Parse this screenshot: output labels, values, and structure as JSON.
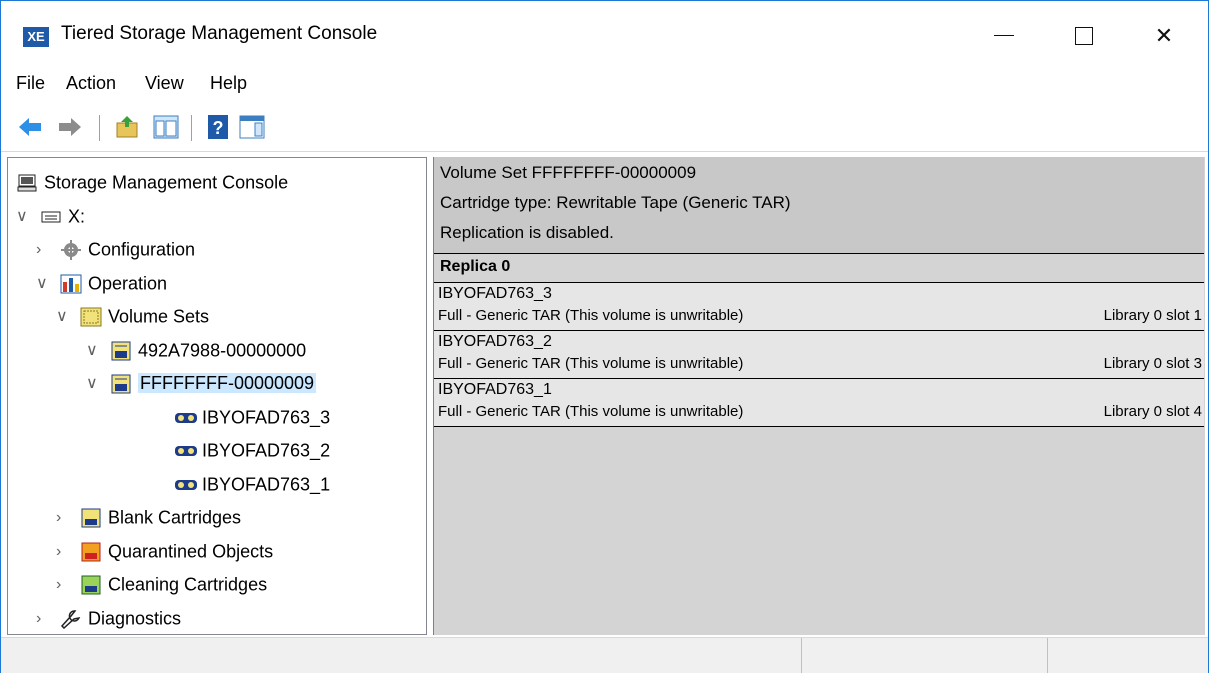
{
  "window": {
    "app_icon_text": "XE",
    "title": "Tiered Storage Management Console"
  },
  "menu": [
    "File",
    "Action",
    "View",
    "Help"
  ],
  "toolbar": {
    "buttons": [
      "back-arrow-icon",
      "forward-arrow-icon",
      "up-folder-icon",
      "show-hide-tree-icon",
      "help-icon",
      "action-pane-icon"
    ]
  },
  "tree": {
    "items": [
      {
        "label": "Storage Management Console",
        "icon": "computer-icon",
        "expander": ""
      },
      {
        "label": "X:",
        "icon": "drive-icon",
        "expander": "∨"
      },
      {
        "label": "Configuration",
        "icon": "gear-icon",
        "expander": "›"
      },
      {
        "label": "Operation",
        "icon": "operation-icon",
        "expander": "∨"
      },
      {
        "label": "Volume Sets",
        "icon": "volume-sets-icon",
        "expander": "∨"
      },
      {
        "label": "492A7988-00000000",
        "icon": "volume-set-icon",
        "expander": "∨"
      },
      {
        "label": "FFFFFFFF-00000009",
        "icon": "volume-set-icon",
        "expander": "∨",
        "selected": true
      },
      {
        "label": "IBYOFAD763_3",
        "icon": "tape-icon",
        "expander": ""
      },
      {
        "label": "IBYOFAD763_2",
        "icon": "tape-icon",
        "expander": ""
      },
      {
        "label": "IBYOFAD763_1",
        "icon": "tape-icon",
        "expander": ""
      },
      {
        "label": "Blank Cartridges",
        "icon": "blank-cartridges-icon",
        "expander": "›"
      },
      {
        "label": "Quarantined Objects",
        "icon": "quarantined-icon",
        "expander": "›"
      },
      {
        "label": "Cleaning Cartridges",
        "icon": "cleaning-icon",
        "expander": "›"
      },
      {
        "label": "Diagnostics",
        "icon": "wrench-icon",
        "expander": "›"
      }
    ]
  },
  "details": {
    "header_lines": [
      "Volume Set FFFFFFFF-00000009",
      "Cartridge type: Rewritable Tape (Generic TAR)",
      "Replication is disabled."
    ],
    "replica_title": "Replica 0",
    "volumes": [
      {
        "name": "IBYOFAD763_3",
        "desc": "Full - Generic TAR (This volume is unwritable)",
        "slot": "Library 0 slot 1"
      },
      {
        "name": "IBYOFAD763_2",
        "desc": "Full - Generic TAR (This volume is unwritable)",
        "slot": "Library 0 slot 3"
      },
      {
        "name": "IBYOFAD763_1",
        "desc": "Full - Generic TAR (This volume is unwritable)",
        "slot": "Library 0 slot 4"
      }
    ]
  }
}
